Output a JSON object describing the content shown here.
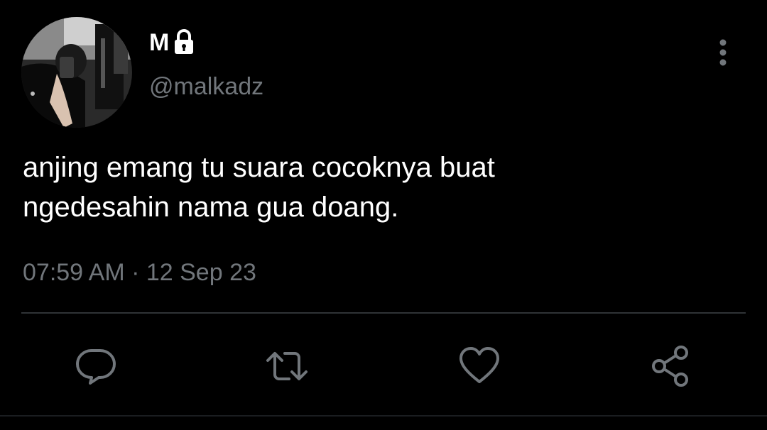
{
  "user": {
    "display_name": "M",
    "handle": "@malkadz",
    "protected_icon": "lock-icon",
    "avatar_icon": "profile-photo"
  },
  "tweet": {
    "text_lines": [
      "anjing emang tu suara cocoknya buat",
      "ngedesahin nama gua doang."
    ],
    "timestamp": "07:59 AM · 12 Sep 23"
  },
  "actions": {
    "reply_icon": "speech-bubble-icon",
    "retweet_icon": "retweet-icon",
    "like_icon": "heart-icon",
    "share_icon": "share-icon",
    "more_icon": "vertical-ellipsis-icon"
  },
  "colors": {
    "background": "#000000",
    "primary_text": "#ffffff",
    "secondary_text": "#71767b",
    "divider": "#2f3336"
  }
}
